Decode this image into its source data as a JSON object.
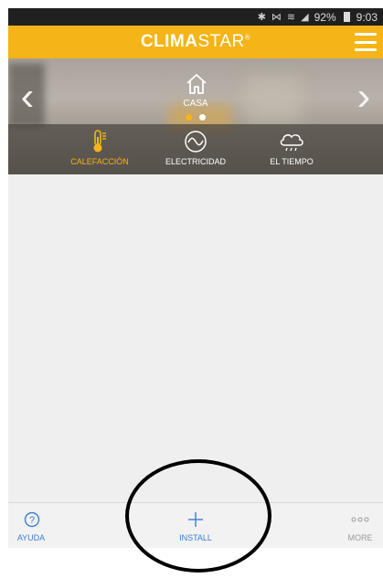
{
  "status_bar": {
    "battery": "92%",
    "time": "9:03",
    "icons": [
      "bluetooth-icon",
      "mute-icon",
      "wifi-icon",
      "signal-icon",
      "battery-icon"
    ]
  },
  "header": {
    "brand_bold": "CLIMA",
    "brand_light": "STAR",
    "brand_mark": "®",
    "menu_icon": "hamburger-menu-icon"
  },
  "hero": {
    "location_label": "CASA",
    "location_icon": "home-icon",
    "pager": {
      "count": 2,
      "active_index": 0
    },
    "prev_icon": "chevron-left-icon",
    "next_icon": "chevron-right-icon"
  },
  "tabs": [
    {
      "label": "CALEFACCIÓN",
      "icon": "thermometer-icon",
      "active": true
    },
    {
      "label": "ELECTRICIDAD",
      "icon": "electricity-wave-icon",
      "active": false
    },
    {
      "label": "EL TIEMPO",
      "icon": "weather-cloud-icon",
      "active": false
    }
  ],
  "bottom_nav": {
    "help": {
      "label": "AYUDA",
      "icon": "question-circle-icon"
    },
    "install": {
      "label": "INSTALL",
      "icon": "plus-icon"
    },
    "more": {
      "label": "MORE",
      "icon": "more-dots-icon"
    }
  },
  "colors": {
    "accent": "#f5b418",
    "link_blue": "#3b7dd8",
    "status_bar_bg": "#202020"
  }
}
